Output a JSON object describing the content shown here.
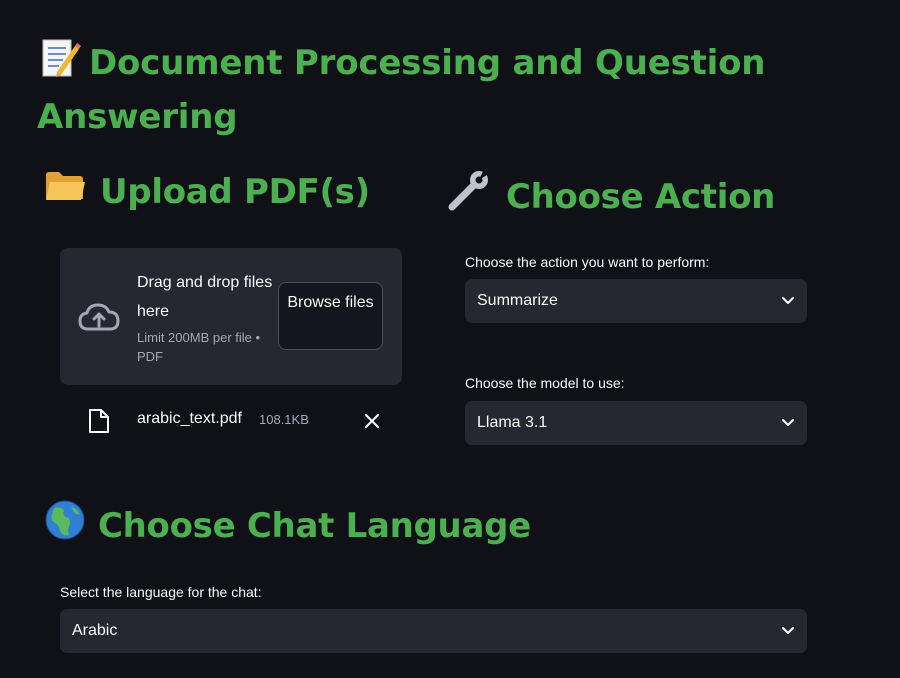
{
  "header": {
    "emoji": "📝",
    "title": "Document Processing and Question Answering"
  },
  "upload": {
    "emoji": "📂",
    "heading": "Upload PDF(s)",
    "dropzone": {
      "text": "Drag and drop files here",
      "limit": "Limit 200MB per file • PDF",
      "browse_label": "Browse files",
      "icon": "cloud-upload-icon"
    },
    "file": {
      "name": "arabic_text.pdf",
      "size": "108.1KB",
      "icon": "file-icon"
    }
  },
  "action": {
    "emoji": "🔧",
    "heading": "Choose Action",
    "action_label": "Choose the action you want to perform:",
    "action_value": "Summarize",
    "model_label": "Choose the model to use:",
    "model_value": "Llama 3.1"
  },
  "language": {
    "emoji": "🌍",
    "heading": "Choose Chat Language",
    "label": "Select the language for the chat:",
    "value": "Arabic"
  },
  "colors": {
    "background": "#0f1116",
    "accent": "#4caf50",
    "widget": "#262730",
    "muted_text": "#a3a8b8"
  }
}
